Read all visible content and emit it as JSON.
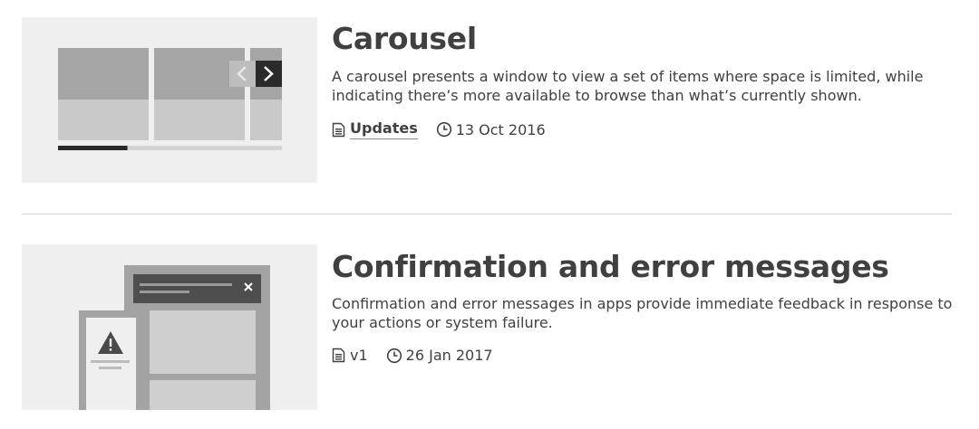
{
  "articles": [
    {
      "title": "Carousel",
      "description": "A carousel presents a window to view a set of items where space is limited, while indicating there’s more available to browse than what’s currently shown.",
      "doc_label": "Updates",
      "doc_icon": "document-icon",
      "date": "13 Oct 2016",
      "date_icon": "clock-icon",
      "progress": 0.31
    },
    {
      "title": "Confirmation and error messages",
      "description": "Confirmation and error messages in apps provide immediate feedback in response to your actions or system failure.",
      "doc_label": "v1",
      "doc_icon": "document-icon",
      "date": "26 Jan 2017",
      "date_icon": "clock-icon"
    }
  ],
  "colors": {
    "text": "#404040",
    "thumb_bg": "#efefef",
    "divider": "#d5d5d5"
  }
}
